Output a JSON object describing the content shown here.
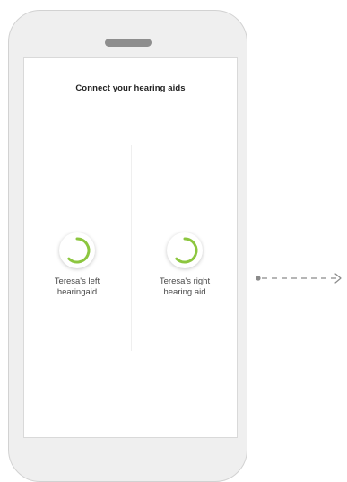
{
  "screen": {
    "title": "Connect your hearing aids"
  },
  "devices": [
    {
      "label_line1": "Teresa's left",
      "label_line2": "hearingaid",
      "status": "connecting"
    },
    {
      "label_line1": "Teresa's right",
      "label_line2": "hearing aid",
      "status": "connecting"
    }
  ],
  "colors": {
    "accent": "#8cc63f",
    "frame": "#efefef",
    "arrow": "#8a8a8a"
  },
  "icons": {
    "spinner": "loading-ring-icon",
    "arrow": "dashed-arrow-right-icon"
  }
}
